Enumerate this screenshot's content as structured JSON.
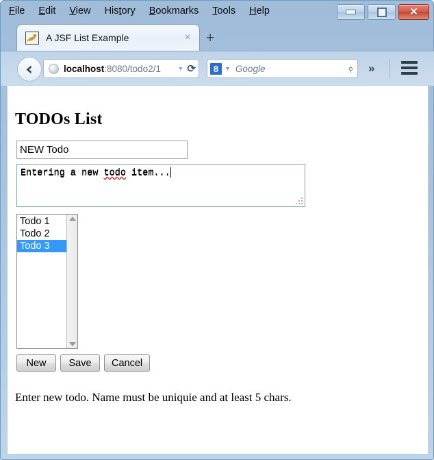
{
  "browser": {
    "menubar": [
      {
        "name": "file",
        "before": "",
        "accesskey": "F",
        "after": "ile"
      },
      {
        "name": "edit",
        "before": "",
        "accesskey": "E",
        "after": "dit"
      },
      {
        "name": "view",
        "before": "",
        "accesskey": "V",
        "after": "iew"
      },
      {
        "name": "history",
        "before": "His",
        "accesskey": "t",
        "after": "ory"
      },
      {
        "name": "bookmarks",
        "before": "",
        "accesskey": "B",
        "after": "ookmarks"
      },
      {
        "name": "tools",
        "before": "",
        "accesskey": "T",
        "after": "ools"
      },
      {
        "name": "help",
        "before": "",
        "accesskey": "H",
        "after": "elp"
      }
    ],
    "window_controls": {
      "minimize_label": "Minimize",
      "maximize_label": "Maximize",
      "close_label": "✕"
    },
    "tab": {
      "title": "A JSF List Example",
      "close_label": "×",
      "favicon": "tomcat-cat-icon"
    },
    "new_tab_label": "+",
    "navigation": {
      "back_label": "←",
      "url_host": "localhost",
      "url_path": ":8080/todo2/1",
      "url_full": "localhost:8080/todo2/1",
      "dropdown_label": "▼",
      "reload_label": "⟳"
    },
    "search": {
      "engine_logo_text": "8",
      "engine_caret": "▼",
      "placeholder": "Google",
      "go_label": "⌕"
    },
    "overflow_label": "»",
    "menu_button_label": "menu"
  },
  "page": {
    "title": "TODOs List",
    "name_input": {
      "value": "NEW Todo",
      "placeholder": ""
    },
    "description_textarea": {
      "value": "Entering a new todo item...",
      "segment_before": "Entering a new ",
      "segment_misspelled": "todo",
      "segment_after": " item...",
      "placeholder": ""
    },
    "todo_list": {
      "options": [
        "Todo 1",
        "Todo 2",
        "Todo 3"
      ],
      "selected": "Todo 3",
      "selected_index": 2
    },
    "buttons": [
      {
        "name": "new",
        "label": "New"
      },
      {
        "name": "save",
        "label": "Save"
      },
      {
        "name": "cancel",
        "label": "Cancel"
      }
    ],
    "hint": "Enter new todo. Name must be uniquie and at least 5 chars."
  },
  "colors": {
    "selection_blue": "#3399ff",
    "chrome_blue": "#a9c3dd",
    "close_red": "#c24730",
    "spellcheck_red": "#e02020",
    "link_host_black": "#0d0d0d"
  }
}
